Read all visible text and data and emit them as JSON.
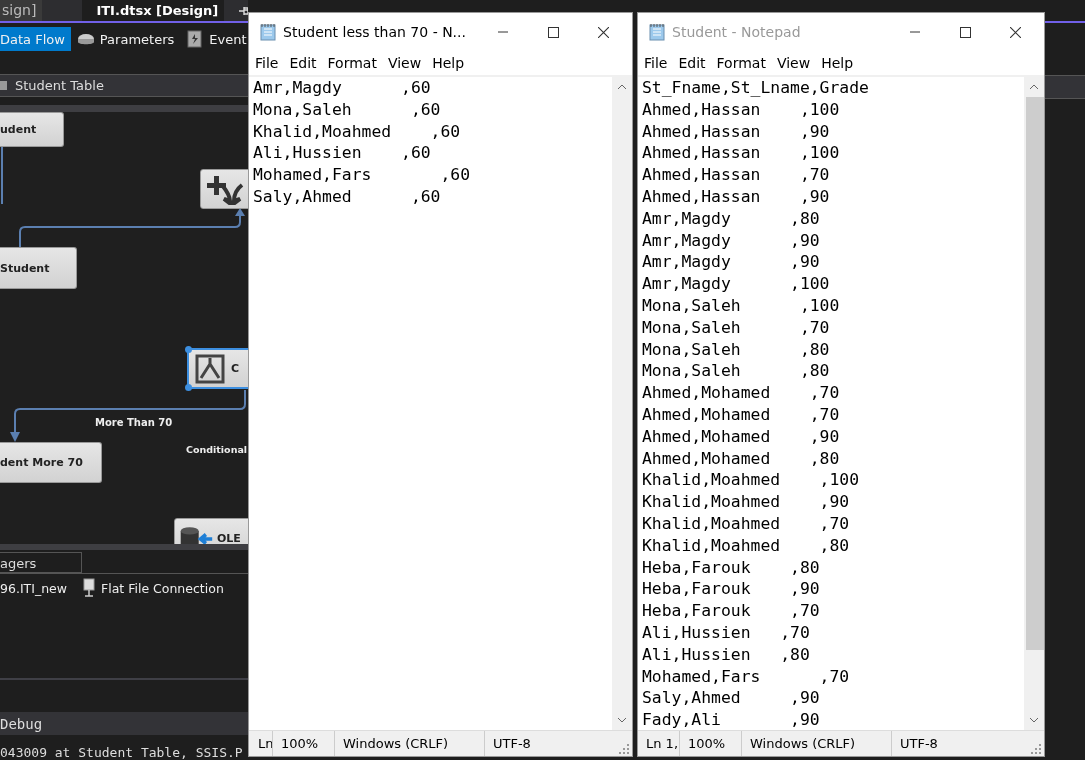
{
  "ide": {
    "doc_tabs": [
      {
        "label": "sign]",
        "selected": false
      },
      {
        "label": "ITI.dtsx [Design]",
        "selected": true
      }
    ],
    "designer_tabs": [
      {
        "label": "Data Flow",
        "selected": true
      },
      {
        "label": "Parameters",
        "selected": false
      },
      {
        "label": "Event",
        "selected": false
      }
    ],
    "task_selector": "Student Table",
    "canvas": {
      "nodes": [
        {
          "kind": "text",
          "label": "udent",
          "selected": false
        },
        {
          "kind": "text",
          "label": "Student",
          "selected": false
        },
        {
          "kind": "merge",
          "selected": false
        },
        {
          "kind": "split",
          "label": "C",
          "selected": true
        },
        {
          "kind": "text",
          "label": "dent More 70",
          "selected": false
        },
        {
          "kind": "destination",
          "label": "OLE",
          "selected": false
        }
      ],
      "path_labels": [
        "More Than 70",
        "Conditional"
      ]
    },
    "connection_managers": {
      "tab": "agers",
      "items": [
        {
          "kind": "database",
          "label": "96.ITI_new"
        },
        {
          "kind": "flat_file",
          "label": "Flat File Connection"
        }
      ]
    },
    "output": {
      "title": "Debug",
      "line": "043009 at Student Table, SSIS.P"
    }
  },
  "notepads": [
    {
      "title": "Student less than 70 - N...",
      "active": true,
      "menu": [
        "File",
        "Edit",
        "Format",
        "View",
        "Help"
      ],
      "lines": [
        "Amr,Magdy      ,60",
        "Mona,Saleh      ,60",
        "Khalid,Moahmed    ,60",
        "Ali,Hussien    ,60",
        "Mohamed,Fars       ,60",
        "Saly,Ahmed      ,60"
      ],
      "status": {
        "position": "Ln",
        "zoom": "100%",
        "line_ending": "Windows (CRLF)",
        "encoding": "UTF-8"
      }
    },
    {
      "title": "Student - Notepad",
      "active": false,
      "menu": [
        "File",
        "Edit",
        "Format",
        "View",
        "Help"
      ],
      "lines": [
        "St_Fname,St_Lname,Grade",
        "Ahmed,Hassan    ,100",
        "Ahmed,Hassan    ,90",
        "Ahmed,Hassan    ,100",
        "Ahmed,Hassan    ,70",
        "Ahmed,Hassan    ,90",
        "Amr,Magdy      ,80",
        "Amr,Magdy      ,90",
        "Amr,Magdy      ,90",
        "Amr,Magdy      ,100",
        "Mona,Saleh      ,100",
        "Mona,Saleh      ,70",
        "Mona,Saleh      ,80",
        "Mona,Saleh      ,80",
        "Ahmed,Mohamed    ,70",
        "Ahmed,Mohamed    ,70",
        "Ahmed,Mohamed    ,90",
        "Ahmed,Mohamed    ,80",
        "Khalid,Moahmed    ,100",
        "Khalid,Moahmed    ,90",
        "Khalid,Moahmed    ,70",
        "Khalid,Moahmed    ,80",
        "Heba,Farouk    ,80",
        "Heba,Farouk    ,90",
        "Heba,Farouk    ,70",
        "Ali,Hussien   ,70",
        "Ali,Hussien   ,80",
        "Mohamed,Fars      ,70",
        "Saly,Ahmed     ,90",
        "Fady,Ali       ,90"
      ],
      "status": {
        "position": "Ln 1,",
        "zoom": "100%",
        "line_ending": "Windows (CRLF)",
        "encoding": "UTF-8"
      }
    }
  ]
}
